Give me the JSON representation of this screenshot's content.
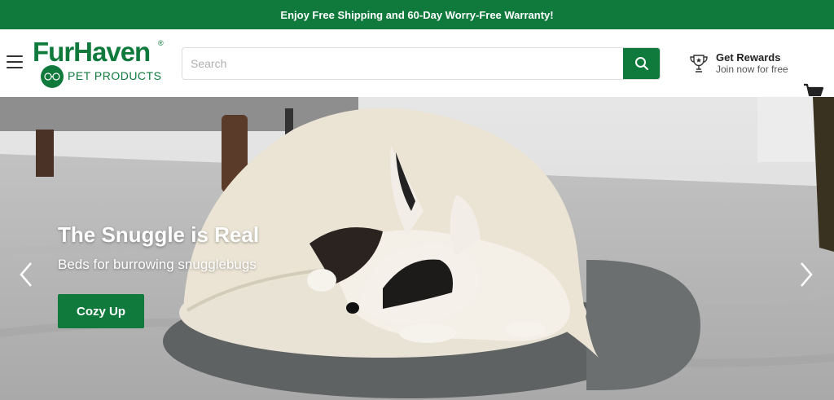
{
  "promo": {
    "text": "Enjoy Free Shipping and 60-Day Worry-Free Warranty!"
  },
  "header": {
    "logo": {
      "name": "FurHaven",
      "registered": "®",
      "subtitle": "PET PRODUCTS"
    },
    "search": {
      "placeholder": "Search",
      "value": ""
    },
    "rewards": {
      "title": "Get Rewards",
      "subtitle": "Join now for free"
    }
  },
  "hero": {
    "title": "The Snuggle is Real",
    "subtitle": "Beds for burrowing snugglebugs",
    "cta": "Cozy Up"
  },
  "colors": {
    "brand_green": "#0f7a3c",
    "header_bg": "#ffffff"
  },
  "icons": [
    "menu-icon",
    "search-icon",
    "trophy-icon",
    "cart-icon",
    "chevron-left-icon",
    "chevron-right-icon"
  ]
}
